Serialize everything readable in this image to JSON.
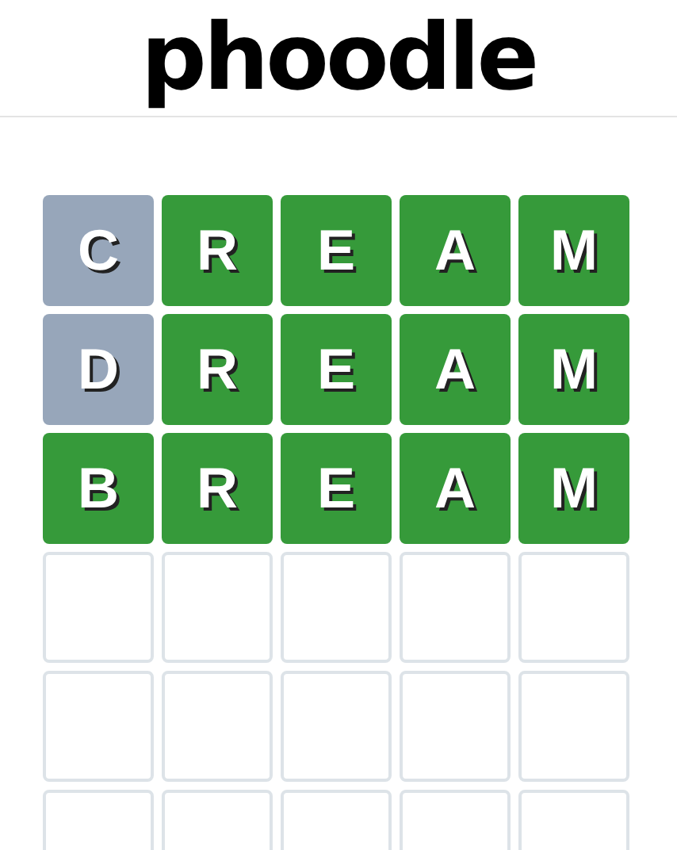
{
  "logo": {
    "text": "phoodle"
  },
  "board": {
    "rows": [
      {
        "tiles": [
          {
            "letter": "C",
            "kind": "absent"
          },
          {
            "letter": "R",
            "kind": "correct"
          },
          {
            "letter": "E",
            "kind": "correct"
          },
          {
            "letter": "A",
            "kind": "correct"
          },
          {
            "letter": "M",
            "kind": "correct"
          }
        ]
      },
      {
        "tiles": [
          {
            "letter": "D",
            "kind": "absent"
          },
          {
            "letter": "R",
            "kind": "correct"
          },
          {
            "letter": "E",
            "kind": "correct"
          },
          {
            "letter": "A",
            "kind": "correct"
          },
          {
            "letter": "M",
            "kind": "correct"
          }
        ]
      },
      {
        "tiles": [
          {
            "letter": "B",
            "kind": "correct"
          },
          {
            "letter": "R",
            "kind": "correct"
          },
          {
            "letter": "E",
            "kind": "correct"
          },
          {
            "letter": "A",
            "kind": "correct"
          },
          {
            "letter": "M",
            "kind": "correct"
          }
        ]
      },
      {
        "tiles": [
          {
            "kind": "empty"
          },
          {
            "kind": "empty"
          },
          {
            "kind": "empty"
          },
          {
            "kind": "empty"
          },
          {
            "kind": "empty"
          }
        ]
      },
      {
        "tiles": [
          {
            "kind": "empty"
          },
          {
            "kind": "empty"
          },
          {
            "kind": "empty"
          },
          {
            "kind": "empty"
          },
          {
            "kind": "empty"
          }
        ]
      },
      {
        "tiles": [
          {
            "kind": "empty"
          },
          {
            "kind": "empty"
          },
          {
            "kind": "empty"
          },
          {
            "kind": "empty"
          },
          {
            "kind": "empty"
          }
        ]
      }
    ]
  }
}
